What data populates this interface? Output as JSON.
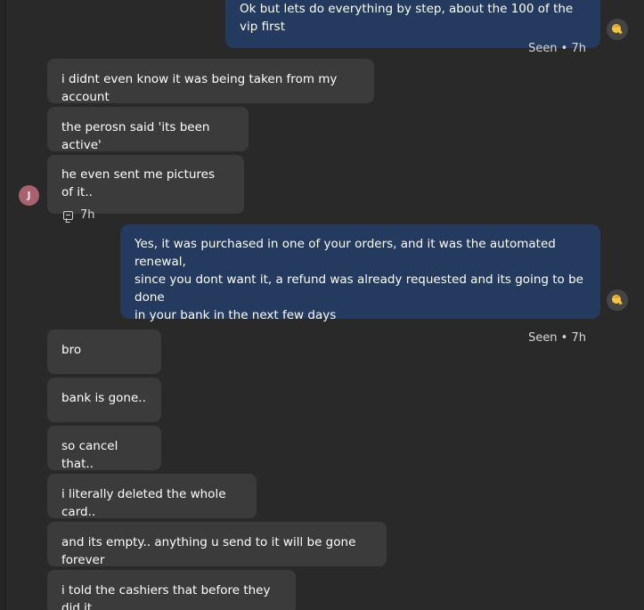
{
  "messages": {
    "out_top": {
      "text": "Ok but lets do everything by step, about the 100 of the vip first",
      "status": "Seen • 7h"
    },
    "in1": "i didnt even know it was being taken from my account",
    "in2": "the perosn said 'its been active'",
    "in3": {
      "text": "he even sent me pictures of it..",
      "time": "7h"
    },
    "out_mid": {
      "line1": "Yes, it was purchased in one of your orders, and it was the automated renewal,",
      "line2": "since you dont want it, a refund was already requested and its going to be done",
      "line3": "in your bank in the next few days",
      "status": "Seen • 7h"
    },
    "in4": "bro",
    "in5": "bank is gone..",
    "in6": "so cancel that..",
    "in7": "i literally deleted the whole card..",
    "in8": "and its empty.. anything u send to it will be gone forever",
    "in9": "i told the cashiers that before they did it"
  },
  "avatar": {
    "customer_initial": "J",
    "customer_color": "#a8626f"
  },
  "icons": {
    "reaction": "reply-icon",
    "agent": "agent-avatar-icon"
  },
  "colors": {
    "background": "#292929",
    "incoming": "#3b3b3b",
    "outgoing": "#243a5e"
  }
}
